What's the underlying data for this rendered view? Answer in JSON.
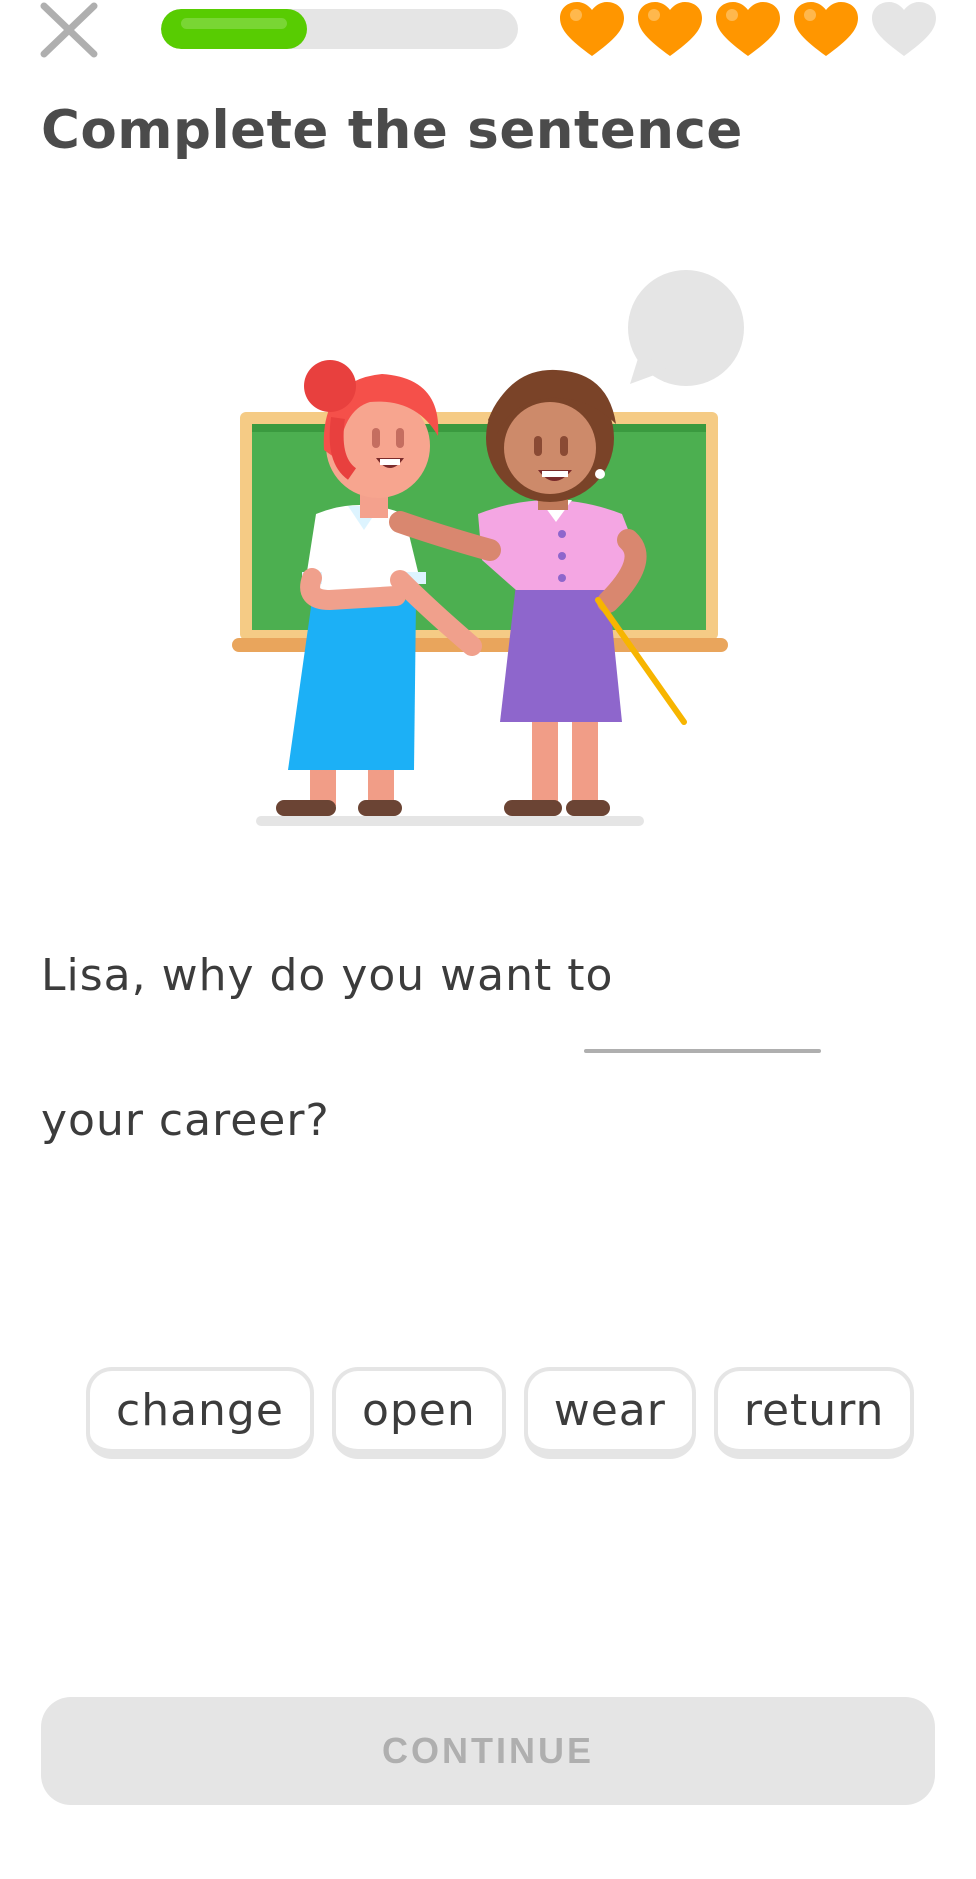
{
  "header": {
    "close_icon": "close-icon",
    "progress": 0.41,
    "hearts": [
      {
        "icon": "heart-icon",
        "filled": true
      },
      {
        "icon": "heart-icon",
        "filled": true
      },
      {
        "icon": "heart-icon",
        "filled": true
      },
      {
        "icon": "heart-icon",
        "filled": true
      },
      {
        "icon": "heart-icon",
        "filled": false
      }
    ]
  },
  "exercise": {
    "title": "Complete the sentence",
    "sentence_part1": "Lisa, why do you want to",
    "sentence_part2": "your career?"
  },
  "word_bank": {
    "words": [
      "change",
      "open",
      "wear",
      "return"
    ]
  },
  "footer": {
    "continue_label": "CONTINUE"
  },
  "colors": {
    "progress_fill": "#58cc02",
    "heart_filled": "#ff9600",
    "heart_empty": "#e5e5e5",
    "disabled_button": "#e5e5e5"
  }
}
